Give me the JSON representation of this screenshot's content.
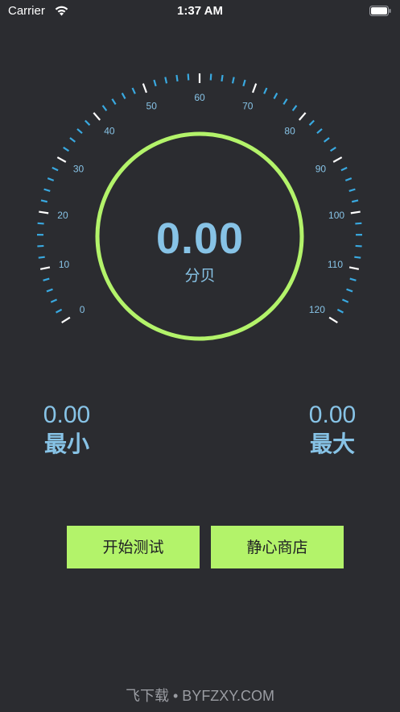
{
  "status_bar": {
    "carrier": "Carrier",
    "time": "1:37 AM"
  },
  "gauge": {
    "tick_labels": [
      "0",
      "10",
      "20",
      "30",
      "40",
      "50",
      "60",
      "70",
      "80",
      "90",
      "100",
      "110",
      "120"
    ],
    "min": 0,
    "max": 120,
    "reading": "0.00",
    "unit": "分贝",
    "tick_color": "#39a9e0",
    "major_tick_color": "#ffffff",
    "ring_color": "#b3f36a"
  },
  "stats": {
    "min_value": "0.00",
    "min_label": "最小",
    "max_value": "0.00",
    "max_label": "最大"
  },
  "buttons": {
    "start_label": "开始测试",
    "store_label": "静心商店"
  },
  "watermark": "飞下载 • BYFZXY.COM"
}
